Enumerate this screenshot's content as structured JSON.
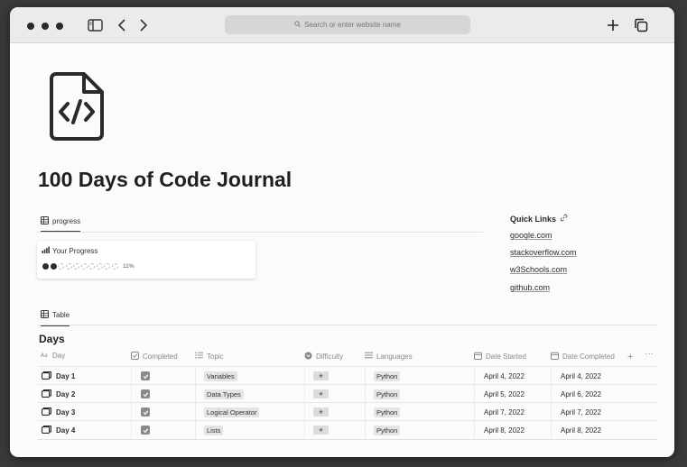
{
  "browser": {
    "url_placeholder": "Search or enter website name"
  },
  "page": {
    "title": "100 Days of Code Journal"
  },
  "progress_view": {
    "tab_label": "progress",
    "card_title": "Your Progress",
    "filled_dots": 2,
    "total_dots": 10,
    "percent_label": "11%"
  },
  "quick_links": {
    "title": "Quick Links",
    "links": [
      "google.com",
      "stackoverflow.com",
      "w3Schools.com",
      "github.com"
    ]
  },
  "table_view": {
    "tab_label": "Table",
    "database_title": "Days",
    "columns": [
      "Day",
      "Completed",
      "Topic",
      "Difficulty",
      "Languages",
      "Date Started",
      "Date Completed"
    ],
    "rows": [
      {
        "day": "Day 1",
        "topic": "Variables",
        "language": "Python",
        "date_started": "April 4, 2022",
        "date_completed": "April 4, 2022"
      },
      {
        "day": "Day 2",
        "topic": "Data Types",
        "language": "Python",
        "date_started": "April 5, 2022",
        "date_completed": "April 6, 2022"
      },
      {
        "day": "Day 3",
        "topic": "Logical Operator",
        "language": "Python",
        "date_started": "April 7, 2022",
        "date_completed": "April 7, 2022"
      },
      {
        "day": "Day 4",
        "topic": "Lists",
        "language": "Python",
        "date_started": "April 8, 2022",
        "date_completed": "April 8, 2022"
      }
    ]
  }
}
